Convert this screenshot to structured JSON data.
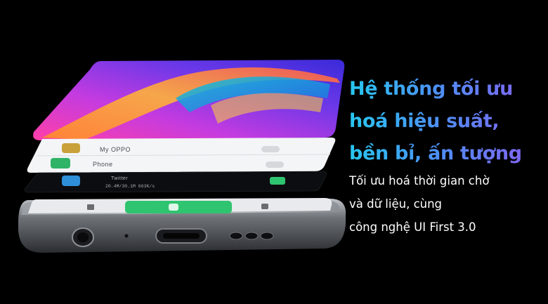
{
  "headline": {
    "line1": "Hệ thống tối ưu",
    "line2": "hoá hiệu suất,",
    "line3": "bền bỉ, ấn tượng"
  },
  "description": {
    "line1": "Tối ưu hoá thời gian chờ",
    "line2": "và dữ liệu, cùng",
    "line3": "công nghệ UI First 3.0"
  },
  "phone": {
    "apps": [
      {
        "name": "My OPPO",
        "icon": "heart-icon",
        "icon_color": "#c9a13a"
      },
      {
        "name": "Phone",
        "icon": "phone-icon",
        "icon_color": "#2fb366"
      },
      {
        "name": "Twitter",
        "icon": "bird-icon",
        "icon_color": "#2f8fd8"
      }
    ],
    "twitter_stats": "20.4M/30.1M   663K/s",
    "accent": "#2fc46f"
  }
}
